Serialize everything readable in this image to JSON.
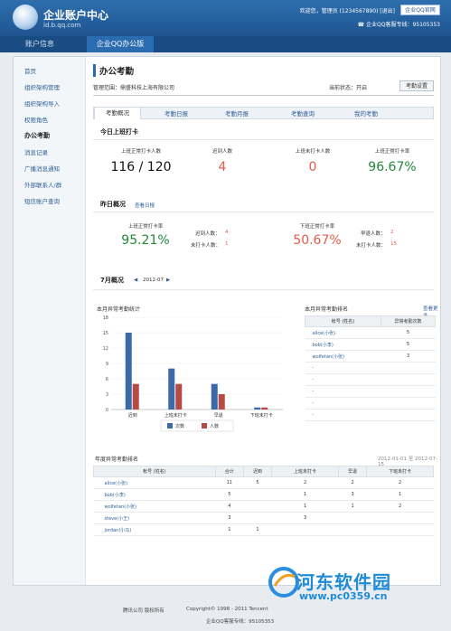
{
  "header": {
    "title": "企业账户中心",
    "domain": "id.b.qq.com",
    "welcome": "欢迎您，管理员 (1234567890) [退出]",
    "qq_button": "企业QQ官网",
    "service": "企业QQ客服专线：95105353"
  },
  "nav": {
    "tabs": [
      {
        "label": "账户信息"
      },
      {
        "label": "企业QQ办公版"
      }
    ]
  },
  "sidebar": {
    "items": [
      {
        "label": "首页"
      },
      {
        "label": "组织架构管理"
      },
      {
        "label": "组织架构导入"
      },
      {
        "label": "权限角色"
      },
      {
        "label": "办公考勤"
      },
      {
        "label": "消息记录"
      },
      {
        "label": "广播消息通知"
      },
      {
        "label": "外部联系人/群"
      },
      {
        "label": "短信账户查询"
      }
    ]
  },
  "page": {
    "title": "办公考勤",
    "scope": "管理范围：鼎盛科技上海有限公司",
    "status": "当前状态：开启",
    "settings_button": "考勤设置"
  },
  "tabs": [
    {
      "label": "考勤概况"
    },
    {
      "label": "考勤日报"
    },
    {
      "label": "考勤月报"
    },
    {
      "label": "考勤查询"
    },
    {
      "label": "我的考勤"
    }
  ],
  "today": {
    "title": "今日上班打卡",
    "stats": [
      {
        "label": "上班正常打卡人数",
        "value": "116 / 120"
      },
      {
        "label": "迟到人数",
        "value": "4"
      },
      {
        "label": "上班未打卡人数",
        "value": "0"
      },
      {
        "label": "上班正常打卡率",
        "value": "96.67%"
      }
    ]
  },
  "yesterday": {
    "title": "昨日概况",
    "link": "查看日报",
    "left_label": "上班正常打卡率",
    "left_value": "95.21%",
    "late_label": "迟到人数：",
    "late_value": "4",
    "miss_label": "未打卡人数：",
    "miss_value": "1",
    "right_label": "下班正常打卡率",
    "right_value": "50.67%",
    "early_label": "早退人数：",
    "early_value": "2",
    "miss2_label": "未打卡人数：",
    "miss2_value": "15"
  },
  "month": {
    "title": "7月概况",
    "date": "2012-07",
    "chart_title": "本月异常考勤统计",
    "rank_title": "本月异常考勤排名",
    "more": "查看更多",
    "rank_headers": [
      "帐号 (姓名)",
      "异常考勤次数"
    ],
    "rank_rows": [
      {
        "name": "alice(小张)",
        "count": "5"
      },
      {
        "name": "bob(小李)",
        "count": "5"
      },
      {
        "name": "wolfetan(小张)",
        "count": "3"
      },
      {
        "name": "-",
        "count": ""
      },
      {
        "name": "-",
        "count": ""
      },
      {
        "name": "-",
        "count": ""
      },
      {
        "name": "-",
        "count": ""
      },
      {
        "name": "-",
        "count": ""
      }
    ]
  },
  "chart_data": {
    "type": "bar",
    "categories": [
      "迟到",
      "上班未打卡",
      "早退",
      "下班未打卡"
    ],
    "series": [
      {
        "name": "次数",
        "values": [
          15,
          8,
          5,
          0.4
        ]
      },
      {
        "name": "人数",
        "values": [
          5,
          5,
          3,
          0.4
        ]
      }
    ],
    "ylim": [
      0,
      18
    ],
    "colors": [
      "#3b6aaa",
      "#b64b46"
    ],
    "legend": "bottom"
  },
  "year": {
    "title": "年度异常考勤排名",
    "range": "2012-01-01 至 2012-07-15",
    "headers": [
      "帐号 (姓名)",
      "合计",
      "迟到",
      "上班未打卡",
      "早退",
      "下班未打卡"
    ],
    "rows": [
      [
        "alice(小张)",
        "11",
        "5",
        "2",
        "2",
        "2"
      ],
      [
        "bob(小李)",
        "5",
        "",
        "1",
        "3",
        "1"
      ],
      [
        "wolfetan(小张)",
        "4",
        "",
        "1",
        "1",
        "2"
      ],
      [
        "steve(小王)",
        "3",
        "",
        "3",
        "",
        ""
      ],
      [
        "jordan(小马)",
        "1",
        "1",
        "",
        "",
        ""
      ]
    ]
  },
  "footer": {
    "company": "腾讯公司 版权所有",
    "copyright": "Copyright© 1998 - 2011 Tencent",
    "service": "企业QQ客服专线：95105353"
  },
  "watermark": {
    "text": "河东软件园",
    "url": "www.pc0359.cn"
  }
}
